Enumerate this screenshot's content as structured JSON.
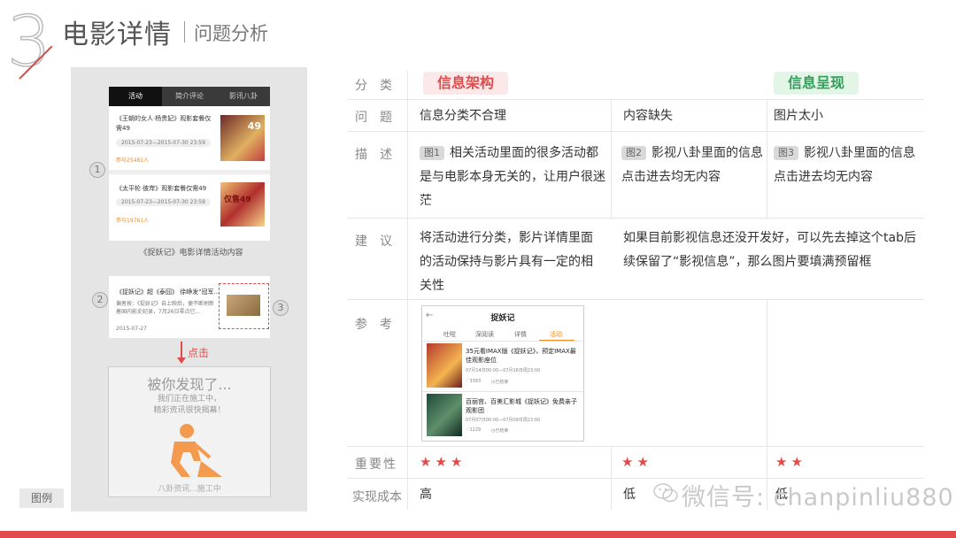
{
  "header": {
    "section_number": "3",
    "title": "电影详情",
    "subtitle": "问题分析"
  },
  "left_panel": {
    "tabs": [
      "活动",
      "简介评论",
      "影讯八卦"
    ],
    "active_tab": 0,
    "activity_cards": [
      {
        "title": "《王朝的女人·杨贵妃》观影套餐仅需49",
        "date": "2015-07-23—2015-07-30 23:59",
        "join": "参与25481人",
        "poster_text": "49"
      },
      {
        "title": "《太平轮·彼岸》观影套餐仅需49",
        "date": "2015-07-23—2015-07-30 23:59",
        "join": "参与19761人",
        "poster_text": "仅售49"
      }
    ],
    "caption": "《捉妖记》电影详情活动内容",
    "markers": [
      "1",
      "2",
      "3"
    ],
    "news_card": {
      "title": "《捉妖记》超《泰囧》 徐峥发\"冠军...",
      "body": "偏者按：《捉妖记》自上映后，便不断刷新着国内影史纪录，7月26日零点已...",
      "date": "2015-07-27"
    },
    "click_label": "点击",
    "construction": {
      "title": "被你发现了...",
      "line1": "我们正在施工中，",
      "line2": "精彩资讯很快揭幕！",
      "footer": "八卦资讯...施工中"
    },
    "legend": "图例"
  },
  "table": {
    "rows": {
      "category": "分类",
      "problem": "问题",
      "description": "描述",
      "suggestion": "建议",
      "reference": "参考",
      "importance": "重要性",
      "cost": "实现成本"
    },
    "categories": {
      "info_architecture": "信息架构",
      "info_presentation": "信息呈现"
    },
    "problems": [
      "信息分类不合理",
      "内容缺失",
      "图片太小"
    ],
    "descriptions": [
      {
        "tag": "图1",
        "text": "相关活动里面的很多活动都是与电影本身无关的，让用户很迷茫"
      },
      {
        "tag": "图2",
        "text": "影视八卦里面的信息点击进去均无内容"
      },
      {
        "tag": "图3",
        "text": "影视八卦里面的信息点击进去均无内容"
      }
    ],
    "suggestions": [
      "将活动进行分类，影片详情里面的活动保持与影片具有一定的相关性",
      "如果目前影视信息还没开发好，可以先去掉这个tab后续保留了“影视信息”，那么图片要填满预留框"
    ],
    "importance": [
      "★★★",
      "★★",
      "★★"
    ],
    "cost": [
      "高",
      "低",
      "低"
    ]
  },
  "reference_mock": {
    "back": "←",
    "title": "捉妖记",
    "tabs": [
      "吐啦",
      "深阅读",
      "详情",
      "活动"
    ],
    "active_tab": 3,
    "items": [
      {
        "text": "35元看IMAX版《捉妖记》，预定IMAX最佳观影座位",
        "date": "07月14日00:00—07月16日周23:00",
        "likes": "♡3383",
        "status": "◷已结束"
      },
      {
        "text": "百丽宫、百美汇影城《捉妖记》免费亲子观影团",
        "date": "07月07日00:00—07月09日周23:00",
        "likes": "♡1229",
        "status": "◷已结束"
      }
    ]
  },
  "watermark": "微信号: chanpinliu880",
  "colors": {
    "accent": "#e14b4b",
    "green": "#2e9e5a",
    "orange": "#f08a24"
  }
}
